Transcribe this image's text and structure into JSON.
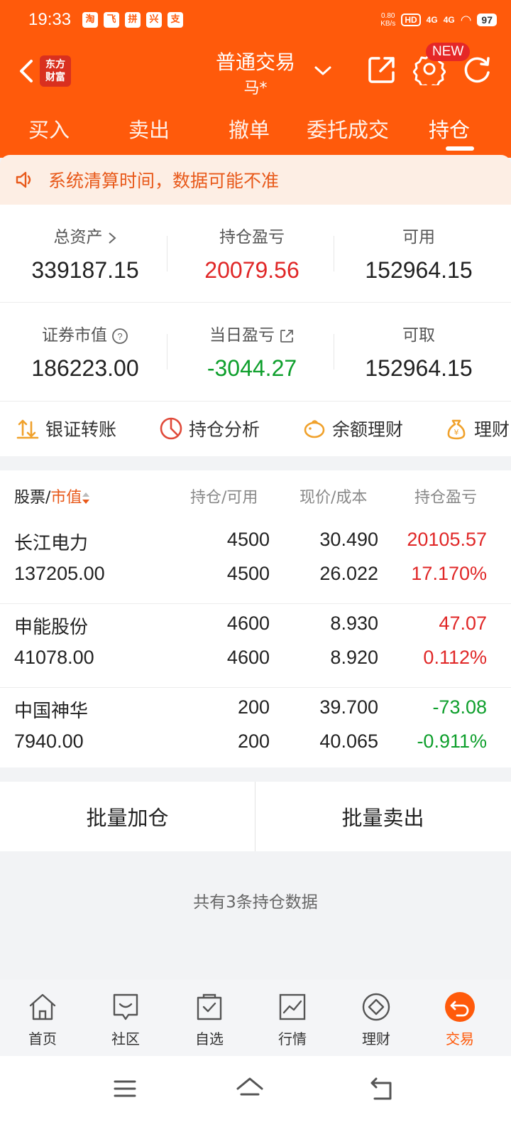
{
  "status_bar": {
    "time": "19:33",
    "apps": [
      "淘",
      "飞",
      "拼",
      "兴",
      "支"
    ],
    "net_speed": "0.80",
    "net_unit": "KB/s",
    "hd": "HD",
    "sim1": "4G",
    "sim2": "4G",
    "battery": "97"
  },
  "nav": {
    "logo_line1": "东方",
    "logo_line2": "财富",
    "title": "普通交易",
    "subtitle": "马*",
    "new_badge": "NEW"
  },
  "tabs": [
    "买入",
    "卖出",
    "撤单",
    "委托成交",
    "持仓"
  ],
  "notice": "系统清算时间，数据可能不准",
  "summary_row1": [
    {
      "label": "总资产",
      "value": "339187.15"
    },
    {
      "label": "持仓盈亏",
      "value": "20079.56"
    },
    {
      "label": "可用",
      "value": "152964.15"
    }
  ],
  "summary_row2": [
    {
      "label": "证券市值",
      "value": "186223.00"
    },
    {
      "label": "当日盈亏",
      "value": "-3044.27"
    },
    {
      "label": "可取",
      "value": "152964.15"
    }
  ],
  "quick_actions": [
    "银证转账",
    "持仓分析",
    "余额理财",
    "理财"
  ],
  "table_header": {
    "stock": "股票/",
    "market_value": "市值",
    "hold": "持仓/可用",
    "price": "现价/成本",
    "pnl": "持仓盈亏"
  },
  "positions": [
    {
      "name": "长江电力",
      "market_value": "137205.00",
      "hold": "4500",
      "available": "4500",
      "price": "30.490",
      "cost": "26.022",
      "pnl": "20105.57",
      "pnl_pct": "17.170%"
    },
    {
      "name": "申能股份",
      "market_value": "41078.00",
      "hold": "4600",
      "available": "4600",
      "price": "8.930",
      "cost": "8.920",
      "pnl": "47.07",
      "pnl_pct": "0.112%"
    },
    {
      "name": "中国神华",
      "market_value": "7940.00",
      "hold": "200",
      "available": "200",
      "price": "39.700",
      "cost": "40.065",
      "pnl": "-73.08",
      "pnl_pct": "-0.911%"
    }
  ],
  "batch": {
    "add": "批量加仓",
    "sell": "批量卖出"
  },
  "summary_text": "共有3条持仓数据",
  "bottom_nav": [
    "首页",
    "社区",
    "自选",
    "行情",
    "理财",
    "交易"
  ],
  "colors": {
    "brand": "#ff5a0b",
    "profit": "#e02727",
    "loss": "#0e9f2c",
    "accent": "#e8591a"
  }
}
